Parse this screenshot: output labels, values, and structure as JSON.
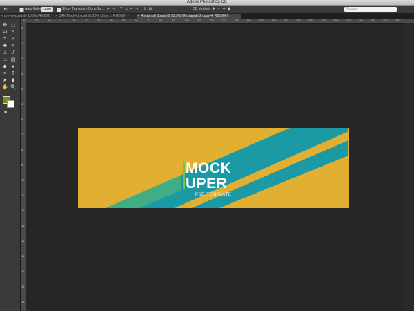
{
  "app": {
    "title": "Adobe Photoshop CC"
  },
  "options": {
    "auto_select_label": "Auto-Select:",
    "auto_select_value": "Layer",
    "show_transform_label": "Show Transform Controls",
    "mode_3d_label": "3D Mode:",
    "search_placeholder": "Google"
  },
  "tabs": [
    {
      "label": "preview.psd @ 100% (RGB/8) *",
      "active": false
    },
    {
      "label": "CAK Mock-Up.psd @ 20% (Side 1, RGB/8#) *",
      "active": false
    },
    {
      "label": "Rectangle 1.psb @ 33,3% (Rectangle 2 copy 4, RGB/8#)",
      "active": true
    }
  ],
  "tools": [
    {
      "name": "move-tool-icon",
      "glyph": "✥"
    },
    {
      "name": "marquee-tool-icon",
      "glyph": "⬚"
    },
    {
      "name": "lasso-tool-icon",
      "glyph": "ᘏ"
    },
    {
      "name": "quick-select-tool-icon",
      "glyph": "✎"
    },
    {
      "name": "crop-tool-icon",
      "glyph": "⌗"
    },
    {
      "name": "eyedropper-tool-icon",
      "glyph": "⌿"
    },
    {
      "name": "healing-tool-icon",
      "glyph": "✚"
    },
    {
      "name": "brush-tool-icon",
      "glyph": "✐"
    },
    {
      "name": "stamp-tool-icon",
      "glyph": "⊥"
    },
    {
      "name": "history-brush-icon",
      "glyph": "↺"
    },
    {
      "name": "eraser-tool-icon",
      "glyph": "▭"
    },
    {
      "name": "gradient-tool-icon",
      "glyph": "▤"
    },
    {
      "name": "blur-tool-icon",
      "glyph": "◆"
    },
    {
      "name": "dodge-tool-icon",
      "glyph": "●"
    },
    {
      "name": "pen-tool-icon",
      "glyph": "✒"
    },
    {
      "name": "type-tool-icon",
      "glyph": "T"
    },
    {
      "name": "path-select-tool-icon",
      "glyph": "➤"
    },
    {
      "name": "shape-tool-icon",
      "glyph": "▮"
    },
    {
      "name": "hand-tool-icon",
      "glyph": "✋"
    },
    {
      "name": "zoom-tool-icon",
      "glyph": "🔍"
    }
  ],
  "swatches": {
    "foreground": "#6e8f16",
    "background": "#ffffff"
  },
  "ruler_top_ticks": [
    "30",
    "20",
    "10",
    "0",
    "10",
    "20",
    "30",
    "40",
    "50",
    "60",
    "70",
    "80",
    "90",
    "100",
    "110",
    "120",
    "130",
    "140",
    "150",
    "160",
    "170",
    "180",
    "190",
    "200",
    "210",
    "220",
    "230",
    "240",
    "250",
    "260",
    "270"
  ],
  "ruler_left_ticks": [
    "0",
    "1",
    "2",
    "3",
    "4",
    "5",
    "6",
    "7",
    "8",
    "9",
    "10",
    "11",
    "12",
    "13",
    "14",
    "15",
    "16",
    "17",
    "18"
  ],
  "canvas": {
    "title_line1": "MOCK",
    "title_line2": "UPER",
    "subtitle": "PSD TEMPLATE",
    "colors": {
      "background": "#e1b033",
      "stripe": "#1b9aa6",
      "accent": "#73c44a"
    }
  }
}
